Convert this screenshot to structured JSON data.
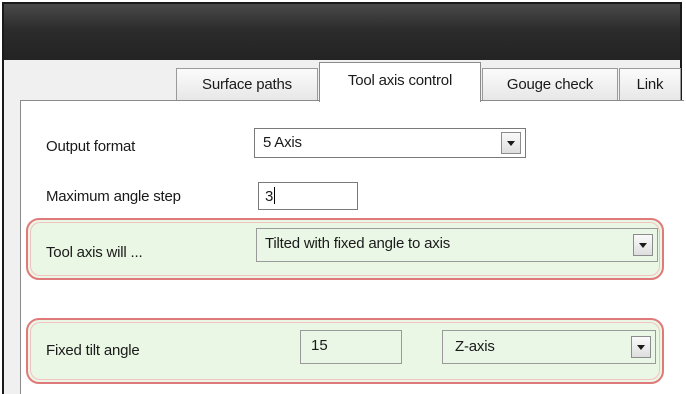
{
  "tabs": [
    {
      "label": "Surface paths",
      "active": false
    },
    {
      "label": "Tool axis control",
      "active": true
    },
    {
      "label": "Gouge check",
      "active": false
    },
    {
      "label": "Link",
      "active": false
    }
  ],
  "fields": {
    "output_format": {
      "label": "Output format",
      "value": "5 Axis"
    },
    "max_angle_step": {
      "label": "Maximum angle step",
      "value": "3"
    },
    "tool_axis": {
      "label": "Tool axis will ...",
      "value": "Tilted with fixed angle to axis"
    },
    "fixed_tilt": {
      "label": "Fixed tilt angle",
      "value": "15",
      "axis_value": "Z-axis"
    }
  },
  "colors": {
    "highlight_border": "#e07a7a",
    "highlight_fill": "#e9f7e4",
    "titlebar": "#2c2c2c"
  }
}
